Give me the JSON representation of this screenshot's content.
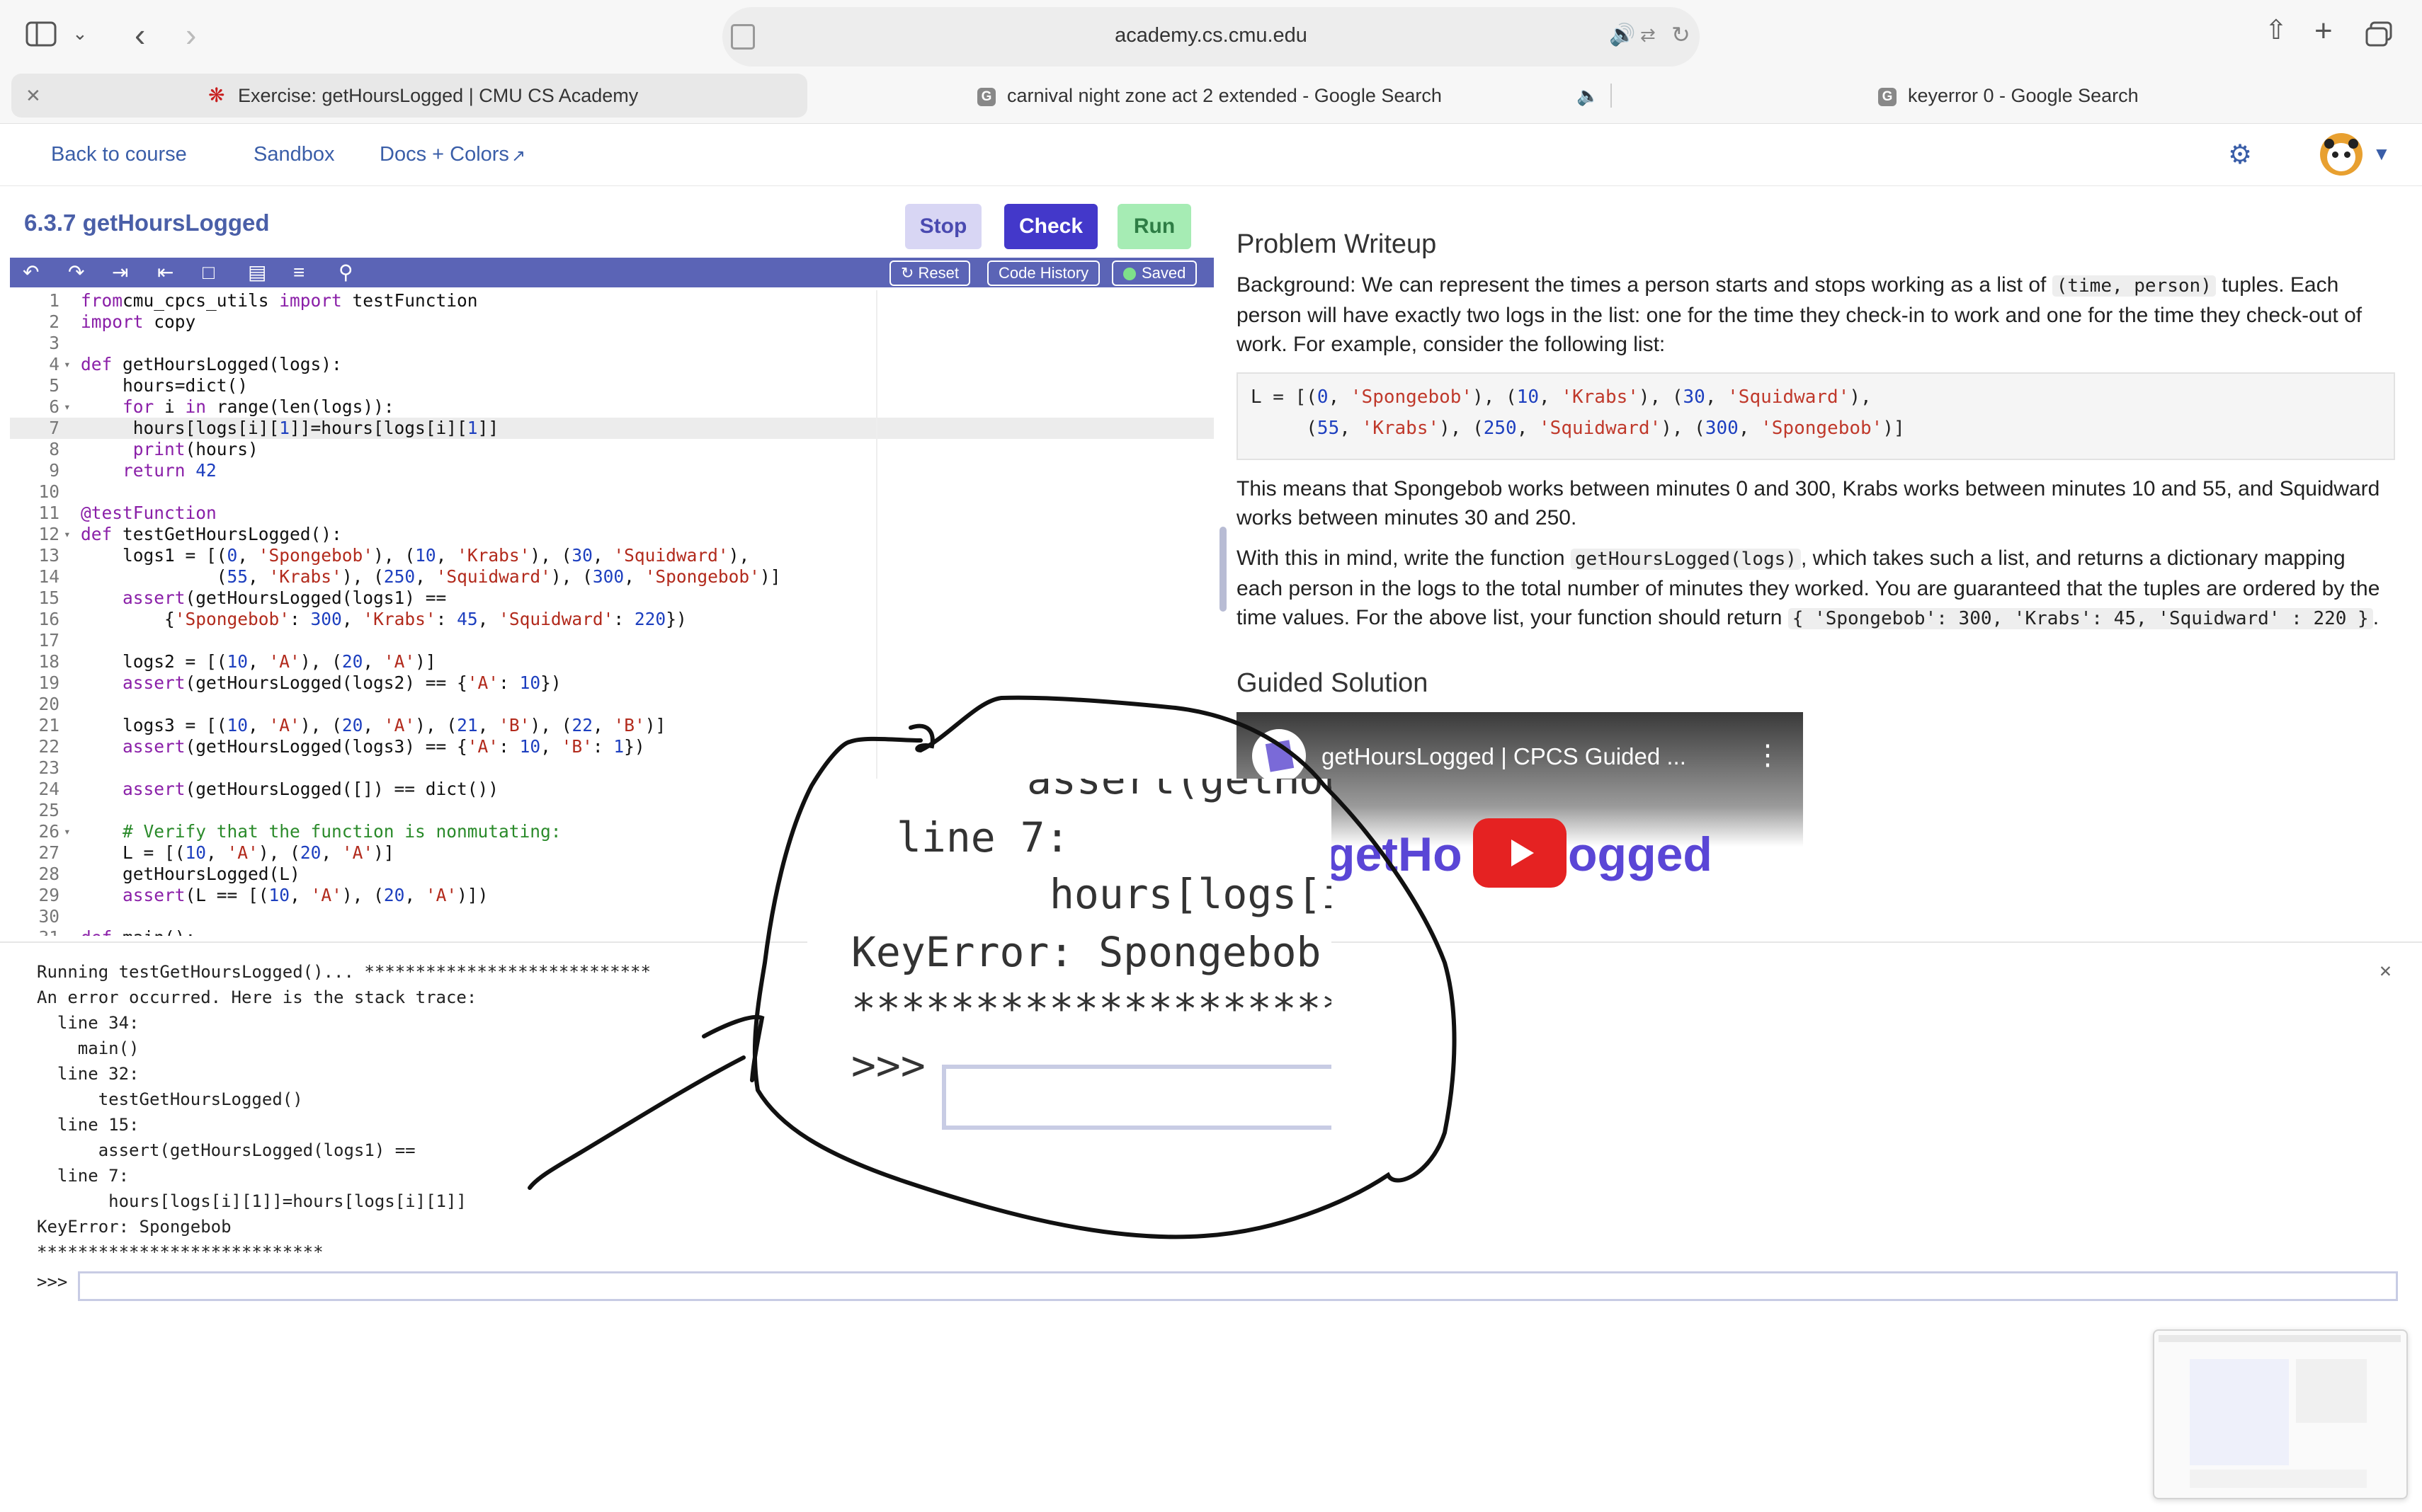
{
  "browser": {
    "url": "academy.cs.cmu.edu",
    "tabs": [
      {
        "label": "Exercise: getHoursLogged | CMU CS Academy",
        "active": true
      },
      {
        "label": "carnival night zone act 2 extended - Google Search",
        "active": false,
        "audio": true
      },
      {
        "label": "keyerror 0 - Google Search",
        "active": false
      }
    ]
  },
  "nav": {
    "back": "Back to course",
    "sandbox": "Sandbox",
    "docs": "Docs + Colors"
  },
  "editor": {
    "title": "6.3.7 getHoursLogged",
    "stop": "Stop",
    "check": "Check",
    "run": "Run",
    "reset": "Reset",
    "code_history": "Code History",
    "saved": "Saved",
    "lines": [
      {
        "n": "1",
        "parts": [
          [
            "kw",
            "from"
          ],
          [
            "",
            "cmu_cpcs_utils "
          ],
          [
            "kw",
            "import"
          ],
          [
            "",
            " testFunction"
          ]
        ]
      },
      {
        "n": "2",
        "parts": [
          [
            "kw",
            "import"
          ],
          [
            "",
            " copy"
          ]
        ]
      },
      {
        "n": "3",
        "parts": []
      },
      {
        "n": "4",
        "fold": true,
        "parts": [
          [
            "kw",
            "def"
          ],
          [
            "",
            " getHoursLogged(logs):"
          ]
        ]
      },
      {
        "n": "5",
        "parts": [
          [
            "",
            "    hours=dict()"
          ]
        ]
      },
      {
        "n": "6",
        "fold": true,
        "parts": [
          [
            "",
            "    "
          ],
          [
            "kw",
            "for"
          ],
          [
            "",
            " i "
          ],
          [
            "kw",
            "in"
          ],
          [
            "",
            " range(len(logs)):"
          ]
        ]
      },
      {
        "n": "7",
        "hl": true,
        "parts": [
          [
            "",
            "     hours[logs[i]["
          ],
          [
            "nm",
            "1"
          ],
          [
            "",
            "]]=hours[logs[i]["
          ],
          [
            "nm",
            "1"
          ],
          [
            "",
            "]]"
          ]
        ]
      },
      {
        "n": "8",
        "parts": [
          [
            "",
            "     "
          ],
          [
            "kw",
            "print"
          ],
          [
            "",
            "(hours)"
          ]
        ]
      },
      {
        "n": "9",
        "parts": [
          [
            "",
            "    "
          ],
          [
            "kw",
            "return"
          ],
          [
            "",
            " "
          ],
          [
            "nm",
            "42"
          ]
        ]
      },
      {
        "n": "10",
        "parts": []
      },
      {
        "n": "11",
        "parts": [
          [
            "kw",
            "@testFunction"
          ]
        ]
      },
      {
        "n": "12",
        "fold": true,
        "parts": [
          [
            "kw",
            "def"
          ],
          [
            "",
            " testGetHoursLogged():"
          ]
        ]
      },
      {
        "n": "13",
        "parts": [
          [
            "",
            "    logs1 = [("
          ],
          [
            "nm",
            "0"
          ],
          [
            ",",
            ", "
          ],
          [
            "st",
            "'Spongebob'"
          ],
          [
            "",
            "), ("
          ],
          [
            "nm",
            "10"
          ],
          [
            "",
            ", "
          ],
          [
            "st",
            "'Krabs'"
          ],
          [
            "",
            "), ("
          ],
          [
            "nm",
            "30"
          ],
          [
            "",
            ", "
          ],
          [
            "st",
            "'Squidward'"
          ],
          [
            "",
            "),"
          ]
        ]
      },
      {
        "n": "14",
        "parts": [
          [
            "",
            "             ("
          ],
          [
            "nm",
            "55"
          ],
          [
            "",
            ", "
          ],
          [
            "st",
            "'Krabs'"
          ],
          [
            "",
            "), ("
          ],
          [
            "nm",
            "250"
          ],
          [
            "",
            ", "
          ],
          [
            "st",
            "'Squidward'"
          ],
          [
            "",
            "), ("
          ],
          [
            "nm",
            "300"
          ],
          [
            "",
            ", "
          ],
          [
            "st",
            "'Spongebob'"
          ],
          [
            "",
            ")]"
          ]
        ]
      },
      {
        "n": "15",
        "parts": [
          [
            "",
            "    "
          ],
          [
            "kw",
            "assert"
          ],
          [
            "",
            "(getHoursLogged(logs1) =="
          ]
        ]
      },
      {
        "n": "16",
        "parts": [
          [
            "",
            "        {"
          ],
          [
            "st",
            "'Spongebob'"
          ],
          [
            "",
            ": "
          ],
          [
            "nm",
            "300"
          ],
          [
            "",
            ", "
          ],
          [
            "st",
            "'Krabs'"
          ],
          [
            "",
            ": "
          ],
          [
            "nm",
            "45"
          ],
          [
            "",
            ", "
          ],
          [
            "st",
            "'Squidward'"
          ],
          [
            "",
            ": "
          ],
          [
            "nm",
            "220"
          ],
          [
            "",
            "})"
          ]
        ]
      },
      {
        "n": "17",
        "parts": []
      },
      {
        "n": "18",
        "parts": [
          [
            "",
            "    logs2 = [("
          ],
          [
            "nm",
            "10"
          ],
          [
            "",
            ", "
          ],
          [
            "st",
            "'A'"
          ],
          [
            "",
            "), ("
          ],
          [
            "nm",
            "20"
          ],
          [
            "",
            ", "
          ],
          [
            "st",
            "'A'"
          ],
          [
            "",
            ")]"
          ]
        ]
      },
      {
        "n": "19",
        "parts": [
          [
            "",
            "    "
          ],
          [
            "kw",
            "assert"
          ],
          [
            "",
            "(getHoursLogged(logs2) == {"
          ],
          [
            "st",
            "'A'"
          ],
          [
            "",
            ": "
          ],
          [
            "nm",
            "10"
          ],
          [
            "",
            "})"
          ]
        ]
      },
      {
        "n": "20",
        "parts": []
      },
      {
        "n": "21",
        "parts": [
          [
            "",
            "    logs3 = [("
          ],
          [
            "nm",
            "10"
          ],
          [
            "",
            ", "
          ],
          [
            "st",
            "'A'"
          ],
          [
            "",
            "), ("
          ],
          [
            "nm",
            "20"
          ],
          [
            "",
            ", "
          ],
          [
            "st",
            "'A'"
          ],
          [
            "",
            "), ("
          ],
          [
            "nm",
            "21"
          ],
          [
            "",
            ", "
          ],
          [
            "st",
            "'B'"
          ],
          [
            "",
            "), ("
          ],
          [
            "nm",
            "22"
          ],
          [
            "",
            ", "
          ],
          [
            "st",
            "'B'"
          ],
          [
            "",
            ")]"
          ]
        ]
      },
      {
        "n": "22",
        "parts": [
          [
            "",
            "    "
          ],
          [
            "kw",
            "assert"
          ],
          [
            "",
            "(getHoursLogged(logs3) == {"
          ],
          [
            "st",
            "'A'"
          ],
          [
            "",
            ": "
          ],
          [
            "nm",
            "10"
          ],
          [
            "",
            ", "
          ],
          [
            "st",
            "'B'"
          ],
          [
            "",
            ": "
          ],
          [
            "nm",
            "1"
          ],
          [
            "",
            "})"
          ]
        ]
      },
      {
        "n": "23",
        "parts": []
      },
      {
        "n": "24",
        "parts": [
          [
            "",
            "    "
          ],
          [
            "kw",
            "assert"
          ],
          [
            "",
            "(getHoursLogged([]) == dict())"
          ]
        ]
      },
      {
        "n": "25",
        "parts": []
      },
      {
        "n": "26",
        "fold": true,
        "parts": [
          [
            "cm",
            "    # Verify that the function is nonmutating:"
          ]
        ]
      },
      {
        "n": "27",
        "parts": [
          [
            "",
            "    L = [("
          ],
          [
            "nm",
            "10"
          ],
          [
            "",
            ", "
          ],
          [
            "st",
            "'A'"
          ],
          [
            "",
            "), ("
          ],
          [
            "nm",
            "20"
          ],
          [
            "",
            ", "
          ],
          [
            "st",
            "'A'"
          ],
          [
            "",
            ")]"
          ]
        ]
      },
      {
        "n": "28",
        "parts": [
          [
            "",
            "    getHoursLogged(L)"
          ]
        ]
      },
      {
        "n": "29",
        "parts": [
          [
            "",
            "    "
          ],
          [
            "kw",
            "assert"
          ],
          [
            "",
            "(L == [("
          ],
          [
            "nm",
            "10"
          ],
          [
            "",
            ", "
          ],
          [
            "st",
            "'A'"
          ],
          [
            "",
            "), ("
          ],
          [
            "nm",
            "20"
          ],
          [
            "",
            ", "
          ],
          [
            "st",
            "'A'"
          ],
          [
            "",
            ")])"
          ]
        ]
      },
      {
        "n": "30",
        "parts": []
      },
      {
        "n": "31",
        "fold": true,
        "parts": [
          [
            "kw",
            "def"
          ],
          [
            "",
            " main():"
          ]
        ]
      }
    ]
  },
  "console": {
    "lines": [
      "Running testGetHoursLogged()... ****************************",
      "An error occurred. Here is the stack trace:",
      "  line 34:",
      "    main()",
      "  line 32:",
      "      testGetHoursLogged()",
      "  line 15:",
      "      assert(getHoursLogged(logs1) ==",
      "  line 7:",
      "       hours[logs[i][1]]=hours[logs[i][1]]",
      "KeyError: Spongebob",
      "****************************"
    ],
    "prompt": ">>>"
  },
  "writeup": {
    "title": "Problem Writeup",
    "p1_a": "Background: We can represent the times a person starts and stops working as a list of ",
    "p1_code": "(time, person)",
    "p1_b": " tuples. Each person will have exactly two logs in the list: one for the time they check-in to work and one for the time they check-out of work. For example, consider the following list:",
    "code_line1": "L = [(0, 'Spongebob'), (10, 'Krabs'), (30, 'Squidward'),",
    "code_line2": "     (55, 'Krabs'), (250, 'Squidward'), (300, 'Spongebob')]",
    "p2": "This means that Spongebob works between minutes 0 and 300, Krabs works between minutes 10 and 55, and Squidward works between minutes 30 and 250.",
    "p3_a": "With this in mind, write the function ",
    "p3_code1": "getHoursLogged(logs)",
    "p3_b": ", which takes such a list, and returns a dictionary mapping each person in the logs to the total number of minutes they worked. You are guaranteed that the tuples are ordered by the time values. For the above list, your function should return ",
    "p3_code2": "{ 'Spongebob': 300, 'Krabs': 45, 'Squidward' : 220 }",
    "p3_c": ".",
    "guided": "Guided Solution",
    "video_title": "getHoursLogged | CPCS Guided ...",
    "video_overlay_left": "getHo",
    "video_overlay_right": "ogged"
  },
  "zoom": {
    "line1": "assert(getHour",
    "line2": "line 7:",
    "line3": "hours[logs[i]",
    "line4": "KeyError: Spongebob",
    "line5": "**********************",
    "prompt": ">>>"
  }
}
